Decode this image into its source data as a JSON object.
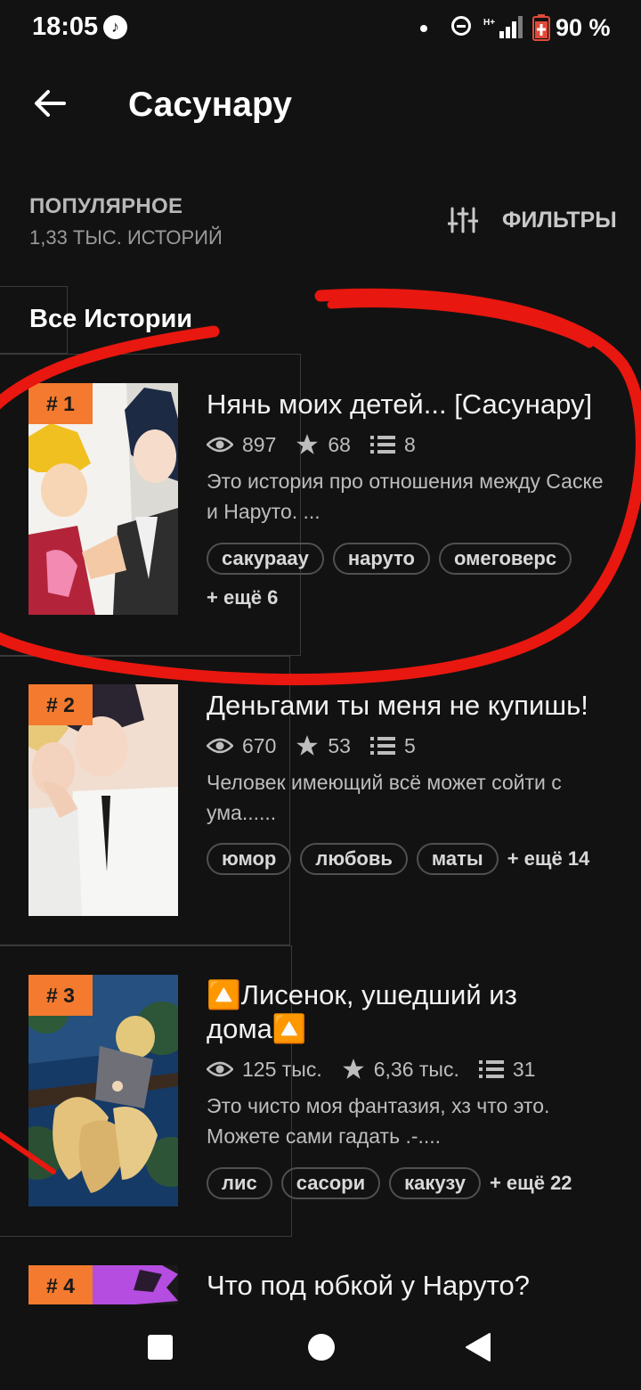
{
  "status_bar": {
    "time": "18:05",
    "battery": "90 %"
  },
  "header": {
    "title": "Сасунару"
  },
  "sort": {
    "title": "ПОПУЛЯРНОЕ",
    "count": "1,33 ТЫС. ИСТОРИЙ",
    "filter_label": "ФИЛЬТРЫ"
  },
  "tab": {
    "label": "Все Истории"
  },
  "stories": [
    {
      "rank": "# 1",
      "title": "Нянь моих детей... [Сасунару]",
      "views": "897",
      "votes": "68",
      "parts": "8",
      "description": "Это история про отношения между Саске и Наруто. ...",
      "tags": [
        "сакураау",
        "наруто",
        "омеговерс"
      ],
      "more": "+ ещё 6"
    },
    {
      "rank": "# 2",
      "title": "Деньгами ты меня не купишь!",
      "views": "670",
      "votes": "53",
      "parts": "5",
      "description": "Человек имеющий всё может сойти с ума......",
      "tags": [
        "юмор",
        "любовь",
        "маты"
      ],
      "more": "+ ещё 14"
    },
    {
      "rank": "# 3",
      "title": "🔼Лисенок, ушедший из дома🔼",
      "views": "125 тыс.",
      "votes": "6,36 тыс.",
      "parts": "31",
      "description": "Это чисто моя фантазия, хз что это. Можете сами гадать .-....",
      "tags": [
        "лис",
        "сасори",
        "какузу"
      ],
      "more": "+ ещё 22"
    },
    {
      "rank": "# 4",
      "title": "Что под юбкой у Наруто?"
    }
  ],
  "colors": {
    "background": "#121212",
    "rank_badge": "#f37a2e",
    "annotation": "#e8170f"
  }
}
